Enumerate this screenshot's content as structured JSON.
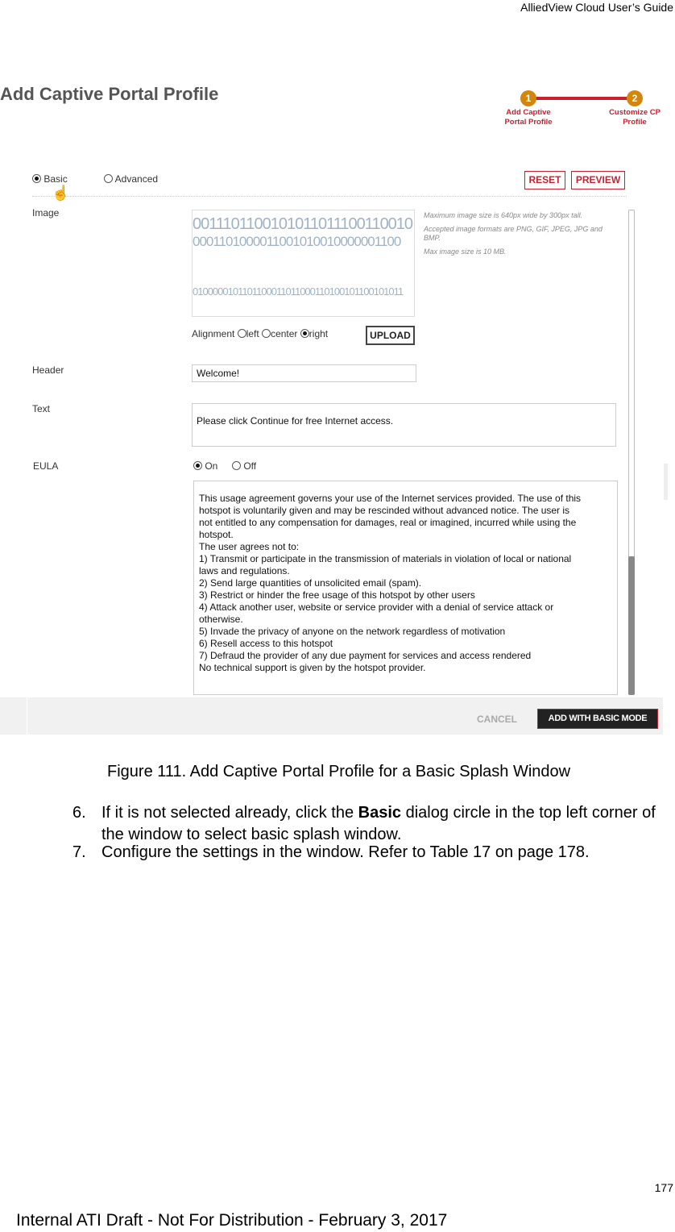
{
  "doc_header": "AlliedView Cloud User’s Guide",
  "screen": {
    "title": "Add Captive Portal Profile",
    "stepper": [
      {
        "num": "1",
        "label": "Add Captive\nPortal Profile"
      },
      {
        "num": "2",
        "label": "Customize CP\nProfile"
      }
    ],
    "mode": {
      "basic": "Basic",
      "advanced": "Advanced",
      "selected": "Basic"
    },
    "reset": "RESET",
    "preview": "PREVIEW",
    "image_label": "Image",
    "image_binary": [
      "0011101100101011011100110010",
      "0001101000011001010010000001100",
      "0100000101101100011011000110100101100101011"
    ],
    "hints": [
      "Maximum image size is 640px wide by 300px tall.",
      "Accepted image formats are PNG, GIF, JPEG, JPG and BMP.",
      "Max image size is 10 MB."
    ],
    "alignment": {
      "label": "Alignment",
      "left": "left",
      "center": "center",
      "right": "right",
      "selected": "right"
    },
    "upload": "UPLOAD",
    "header_label": "Header",
    "header_value": "Welcome!",
    "text_label": "Text",
    "text_value": "Please click Continue for free Internet access.",
    "eula_label": "EULA",
    "eula_on": "On",
    "eula_off": "Off",
    "eula_selected": "On",
    "eula_text": [
      "This usage agreement governs your use of the Internet services provided. The use of this",
      "hotspot is voluntarily given and may be rescinded without advanced notice. The user is",
      "not entitled to any compensation for damages, real or imagined, incurred while using the",
      "hotspot.",
      "The user agrees not to:",
      "1) Transmit or participate in the transmission of materials in violation of local or national",
      "laws and regulations.",
      "2) Send large quantities of unsolicited email (spam).",
      "3) Restrict or hinder the free usage of this hotspot by other users",
      "4) Attack another user, website or service provider with a denial of service attack or",
      "otherwise.",
      "5) Invade the privacy of anyone on the network regardless of motivation",
      "6) Resell access to this hotspot",
      "7) Defraud the provider of any due payment for services and access rendered",
      "No technical support is given by the hotspot provider."
    ],
    "cancel": "CANCEL",
    "add": "ADD WITH BASIC MODE"
  },
  "caption": "Figure 111. Add Captive Portal Profile for a Basic Splash Window",
  "steps": [
    {
      "num": "6.",
      "pre": "If it is not selected already, click the ",
      "bold": "Basic",
      "post": " dialog circle in the top left corner of the window to select basic splash window."
    },
    {
      "num": "7.",
      "text": "Configure the settings in the window. Refer to Table 17 on page 178."
    }
  ],
  "page_number": "177",
  "footer": "Internal ATI Draft - Not For Distribution - February 3, 2017"
}
